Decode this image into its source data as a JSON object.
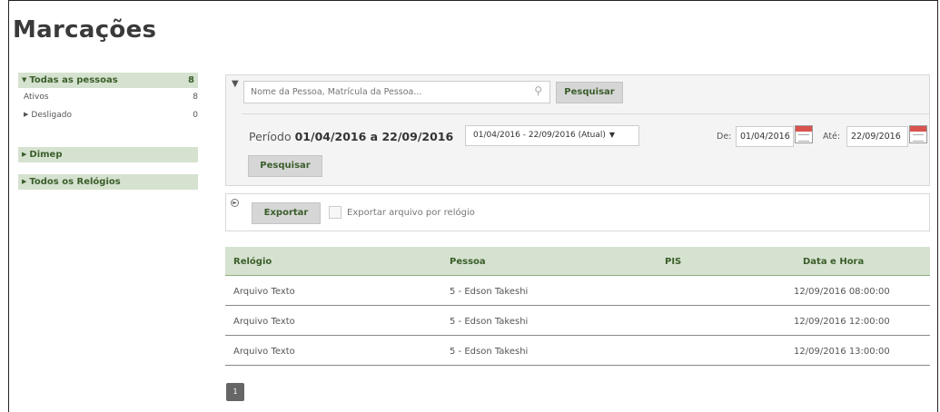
{
  "page": {
    "title": "Marcações"
  },
  "sidebar": {
    "groups": [
      {
        "label": "Todas as pessoas",
        "count": "8"
      },
      {
        "label": "Dimep"
      },
      {
        "label": "Todos os Relógios"
      }
    ],
    "items": [
      {
        "label": "Ativos",
        "count": "8"
      },
      {
        "label": "Desligado",
        "count": "0"
      }
    ]
  },
  "filter": {
    "search_placeholder": "Nome da Pessoa, Matrícula da Pessoa...",
    "search_button": "Pesquisar",
    "periodo_prefix": "Período",
    "periodo_range": "01/04/2016 a 22/09/2016",
    "periodo_select": "01/04/2016 - 22/09/2016 (Atual)",
    "de_label": "De:",
    "de_value": "01/04/2016",
    "ate_label": "Até:",
    "ate_value": "22/09/2016",
    "periodo_button": "Pesquisar"
  },
  "export": {
    "button": "Exportar",
    "checkbox_label": "Exportar arquivo por relógio"
  },
  "table": {
    "headers": [
      "Relógio",
      "Pessoa",
      "PIS",
      "Data e Hora"
    ],
    "rows": [
      {
        "relogio": "Arquivo Texto",
        "pessoa": "5 - Edson Takeshi",
        "pis": "",
        "data": "12/09/2016 08:00:00"
      },
      {
        "relogio": "Arquivo Texto",
        "pessoa": "5 - Edson Takeshi",
        "pis": "",
        "data": "12/09/2016 12:00:00"
      },
      {
        "relogio": "Arquivo Texto",
        "pessoa": "5 - Edson Takeshi",
        "pis": "",
        "data": "12/09/2016 13:00:00"
      }
    ]
  },
  "pagination": {
    "current": "1"
  },
  "colors": {
    "accent_bg": "#d5e2cf",
    "accent_text": "#3b5e2b",
    "pager_bg": "#666666"
  },
  "icons": {
    "filter": "funnel-icon",
    "search": "search-icon",
    "calendar": "calendar-icon",
    "toggle": "collapse-toggle-icon"
  }
}
